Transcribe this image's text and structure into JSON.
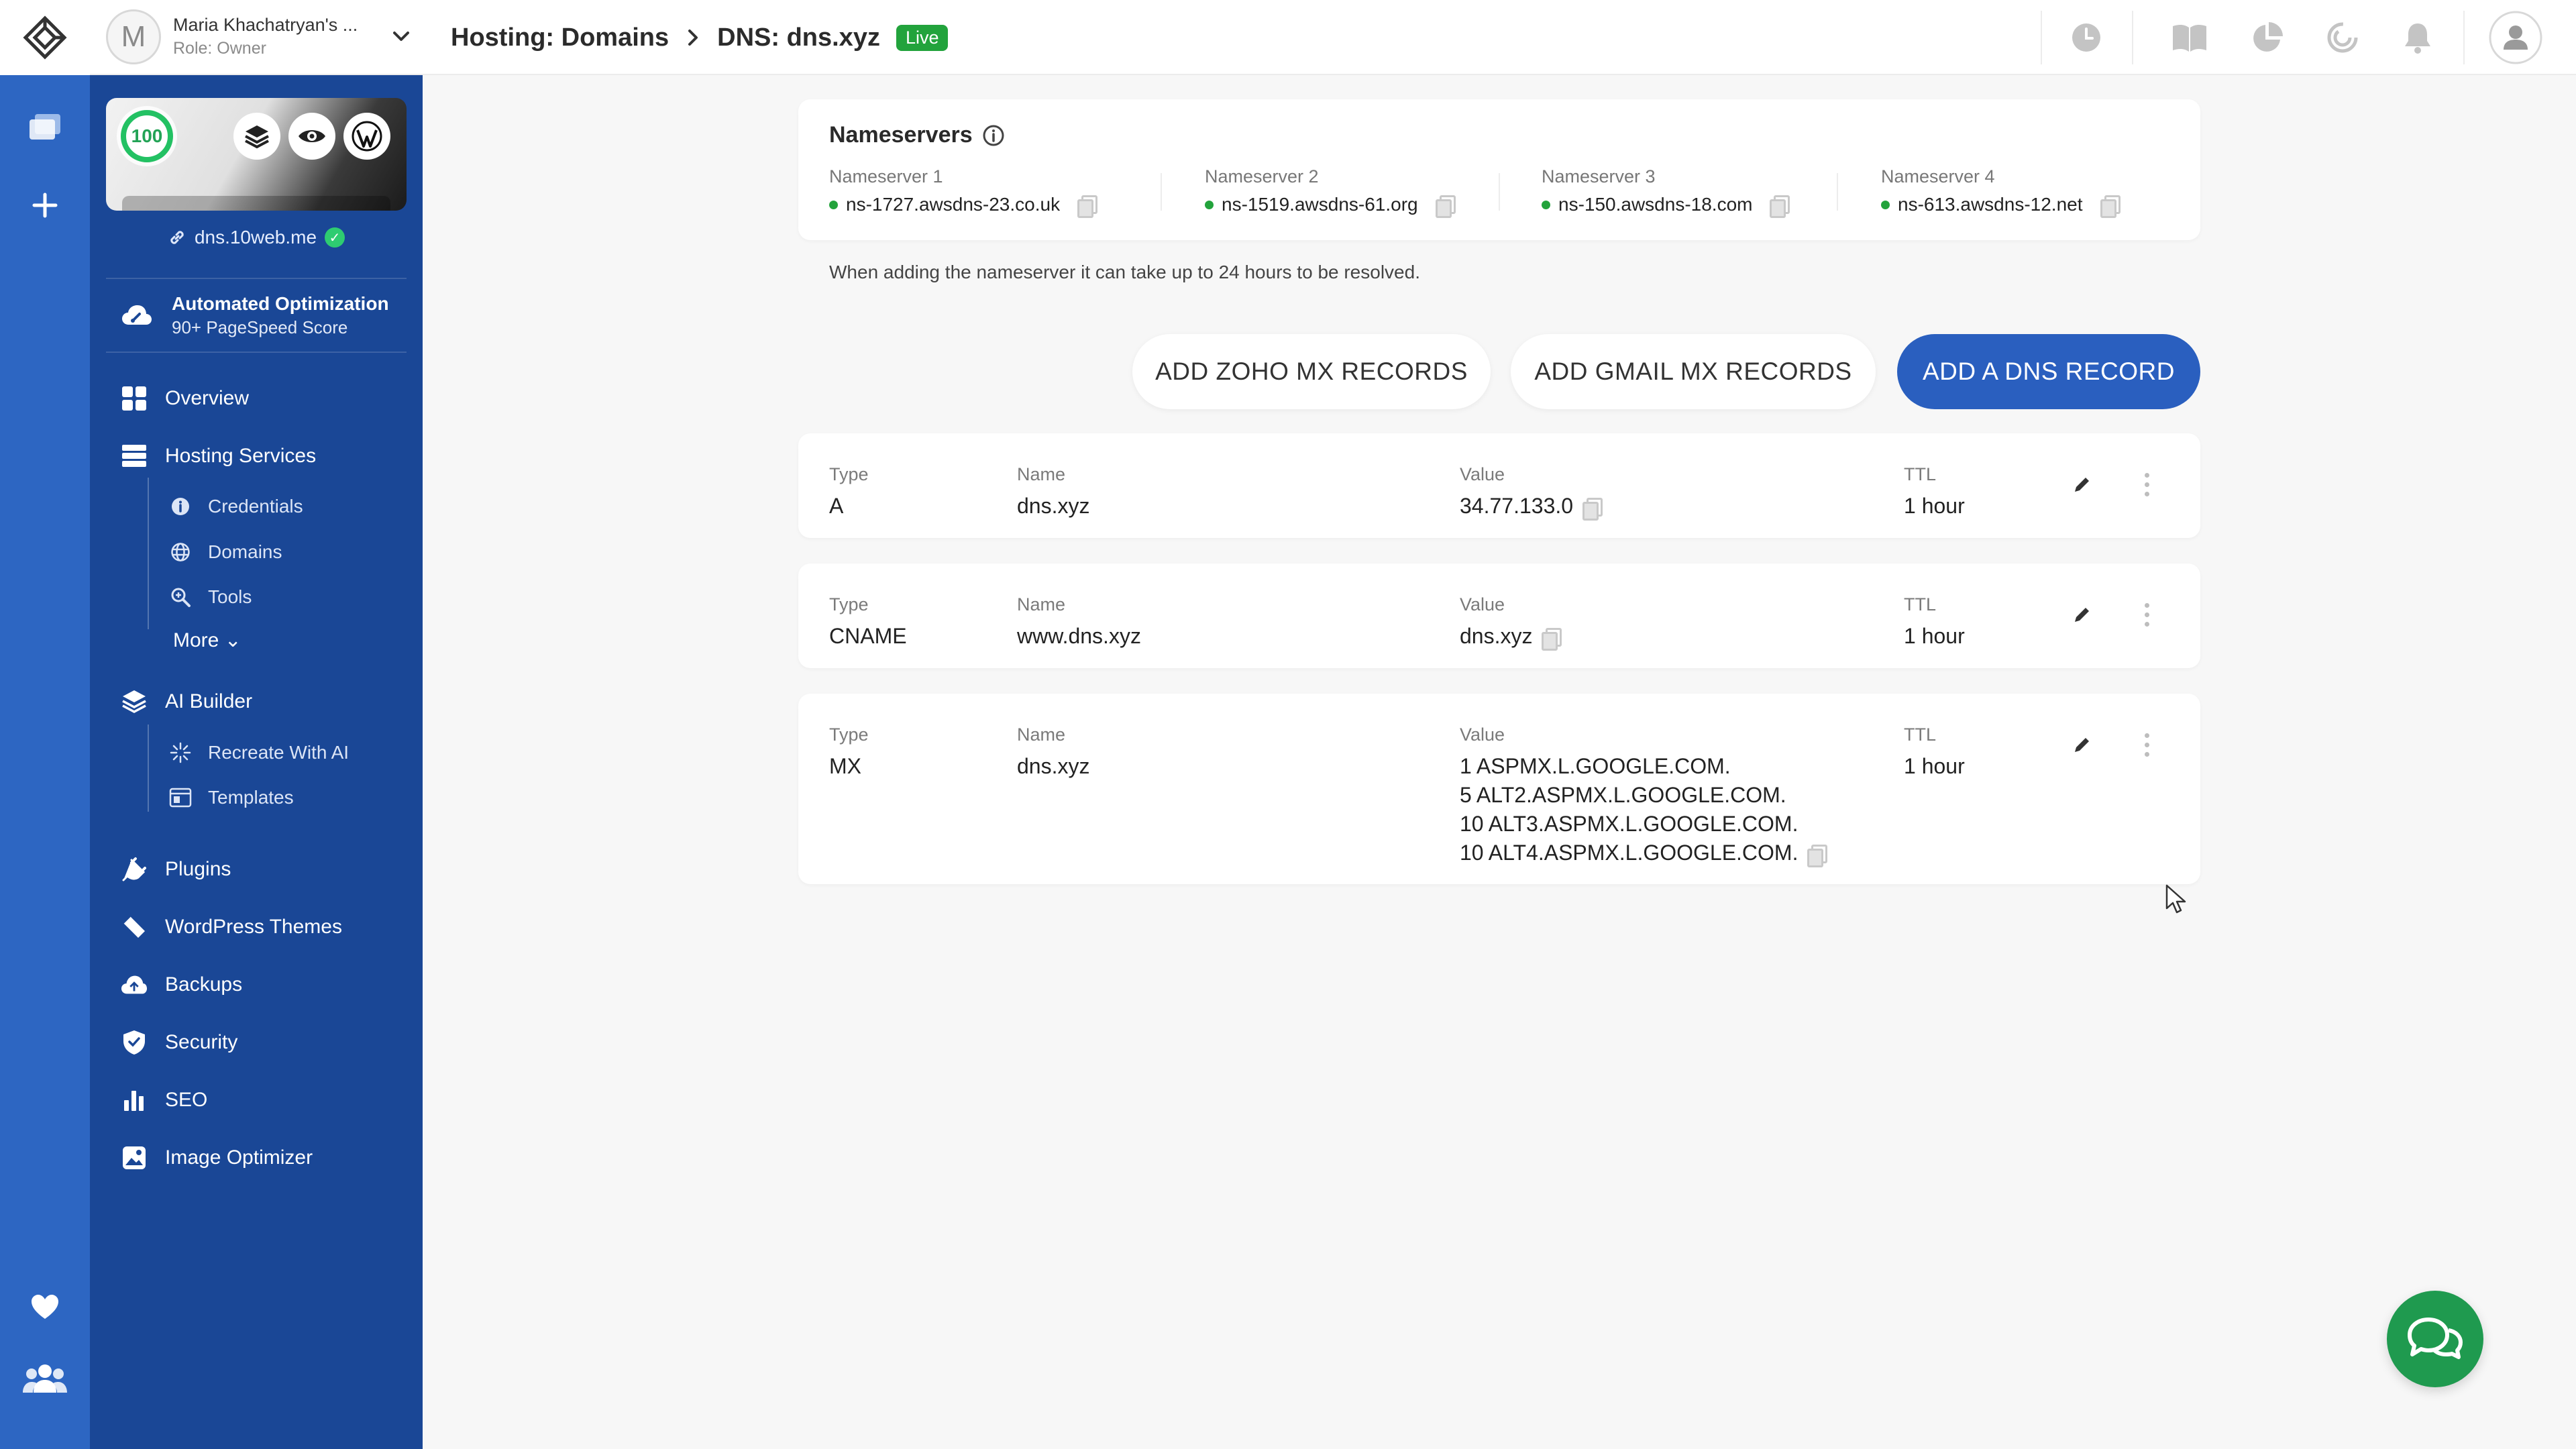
{
  "account": {
    "initial": "M",
    "name": "Maria Khachatryan's ...",
    "role": "Role: Owner"
  },
  "breadcrumb": {
    "parent": "Hosting: Domains",
    "current": "DNS: dns.xyz",
    "status": "Live"
  },
  "site": {
    "score": "100",
    "domain": "dns.10web.me",
    "optimization_title": "Automated Optimization",
    "optimization_sub": "90+ PageSpeed Score"
  },
  "nav": {
    "overview": "Overview",
    "hosting_services": "Hosting Services",
    "credentials": "Credentials",
    "domains": "Domains",
    "tools": "Tools",
    "more": "More ⌄",
    "ai_builder": "AI Builder",
    "recreate": "Recreate With AI",
    "templates": "Templates",
    "plugins": "Plugins",
    "themes": "WordPress Themes",
    "backups": "Backups",
    "security": "Security",
    "seo": "SEO",
    "image_optimizer": "Image Optimizer"
  },
  "nameservers": {
    "title": "Nameservers",
    "note": "When adding the nameserver it can take up to 24 hours to be resolved.",
    "items": [
      {
        "label": "Nameserver 1",
        "value": "ns-1727.awsdns-23.co.uk"
      },
      {
        "label": "Nameserver 2",
        "value": "ns-1519.awsdns-61.org"
      },
      {
        "label": "Nameserver 3",
        "value": "ns-150.awsdns-18.com"
      },
      {
        "label": "Nameserver 4",
        "value": "ns-613.awsdns-12.net"
      }
    ]
  },
  "actions": {
    "zoho": "ADD ZOHO MX RECORDS",
    "gmail": "ADD GMAIL MX RECORDS",
    "add_dns": "ADD A DNS RECORD"
  },
  "record_labels": {
    "type": "Type",
    "name": "Name",
    "value": "Value",
    "ttl": "TTL"
  },
  "records": [
    {
      "type": "A",
      "name": "dns.xyz",
      "value": [
        "34.77.133.0"
      ],
      "ttl": "1 hour"
    },
    {
      "type": "CNAME",
      "name": "www.dns.xyz",
      "value": [
        "dns.xyz"
      ],
      "ttl": "1 hour"
    },
    {
      "type": "MX",
      "name": "dns.xyz",
      "value": [
        "1 ASPMX.L.GOOGLE.COM.",
        "5 ALT2.ASPMX.L.GOOGLE.COM.",
        "10 ALT3.ASPMX.L.GOOGLE.COM.",
        "10 ALT4.ASPMX.L.GOOGLE.COM."
      ],
      "ttl": "1 hour"
    }
  ],
  "colors": {
    "rail": "#2d66c2",
    "sidebar": "#1a4796",
    "primary": "#2a5fbf",
    "live": "#22a33c",
    "chat": "#1f9a4f"
  }
}
